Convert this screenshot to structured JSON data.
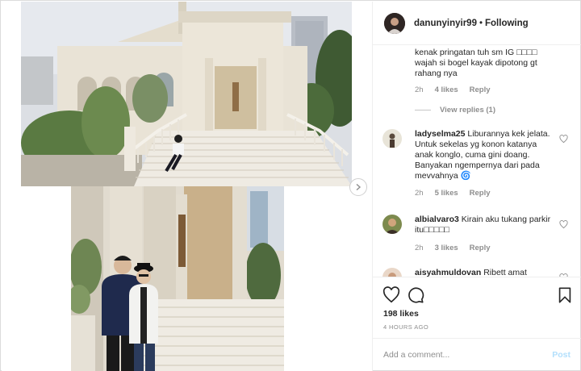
{
  "header": {
    "username": "danunyinyir99",
    "separator": "•",
    "follow_status": "Following"
  },
  "comments": {
    "continued": {
      "text": "kenak pringatan tuh sm IG □□□□ wajah si bogel kayak dipotong gt rahang nya",
      "time": "2h",
      "likes": "4 likes",
      "reply": "Reply"
    },
    "view_replies": "View replies (1)",
    "items": [
      {
        "username": "ladyselma25",
        "text": "Liburannya kek jelata. Untuk sekelas yg konon katanya anak konglo, cuma gini doang. Banyakan ngempernya dari pada mevvahnya",
        "emoji": "🌀",
        "time": "2h",
        "likes": "5 likes",
        "reply": "Reply"
      },
      {
        "username": "albialvaro3",
        "text": "Kirain aku tukang parkir itu□□□□□",
        "time": "2h",
        "likes": "3 likes",
        "reply": "Reply"
      },
      {
        "username": "aisyahmuldovan",
        "text": "Ribett amat"
      }
    ]
  },
  "actions": {
    "likes": "198 likes",
    "time_ago": "4 HOURS AGO"
  },
  "add_comment": {
    "placeholder": "Add a comment...",
    "post_label": "Post"
  },
  "colors": {
    "accent_post_disabled": "#b2dffc",
    "muted_text": "#8e8e8e",
    "border": "#dbdbdb"
  }
}
